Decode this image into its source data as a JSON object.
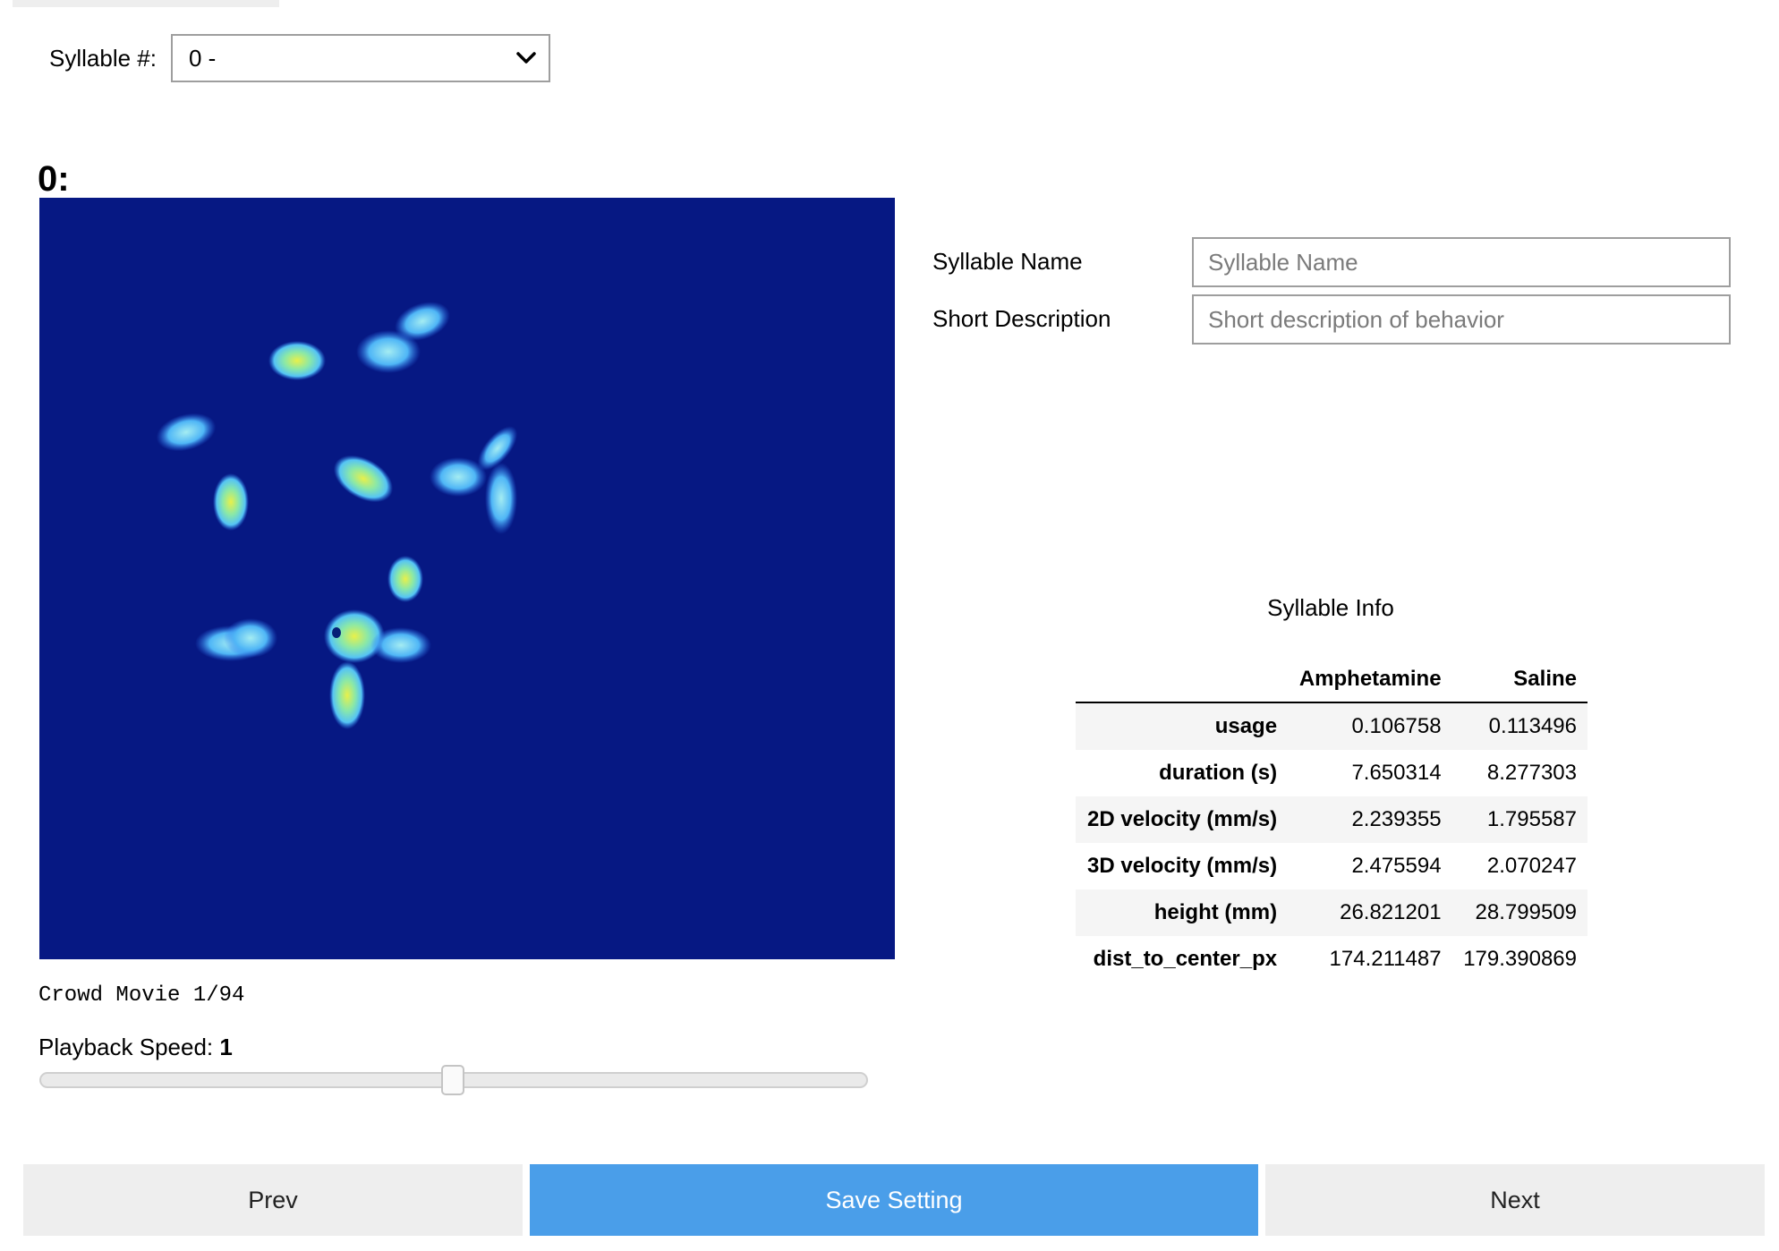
{
  "selector": {
    "label": "Syllable #:",
    "selected": "0 -"
  },
  "heading": "0:",
  "movie": {
    "caption": "Crowd Movie 1/94"
  },
  "playback": {
    "label": "Playback Speed:",
    "value": "1",
    "level_fraction": 0.5
  },
  "fields": {
    "name": {
      "label": "Syllable Name",
      "placeholder": "Syllable Name",
      "value": ""
    },
    "description": {
      "label": "Short Description",
      "placeholder": "Short description of behavior",
      "value": ""
    }
  },
  "info": {
    "title": "Syllable Info",
    "columns": [
      "",
      "Amphetamine",
      "Saline"
    ],
    "rows": [
      {
        "label": "usage",
        "values": [
          "0.106758",
          "0.113496"
        ]
      },
      {
        "label": "duration (s)",
        "values": [
          "7.650314",
          "8.277303"
        ]
      },
      {
        "label": "2D velocity (mm/s)",
        "values": [
          "2.239355",
          "1.795587"
        ]
      },
      {
        "label": "3D velocity (mm/s)",
        "values": [
          "2.475594",
          "2.070247"
        ]
      },
      {
        "label": "height (mm)",
        "values": [
          "26.821201",
          "28.799509"
        ]
      },
      {
        "label": "dist_to_center_px",
        "values": [
          "174.211487",
          "179.390869"
        ]
      }
    ]
  },
  "buttons": {
    "prev": "Prev",
    "save": "Save Setting",
    "next": "Next"
  },
  "colors": {
    "movie_bg": "#061883",
    "save_button": "#4a9ee9",
    "nav_button": "#eeeeee"
  },
  "icons": {
    "dropdown": "chevron-down-icon"
  }
}
